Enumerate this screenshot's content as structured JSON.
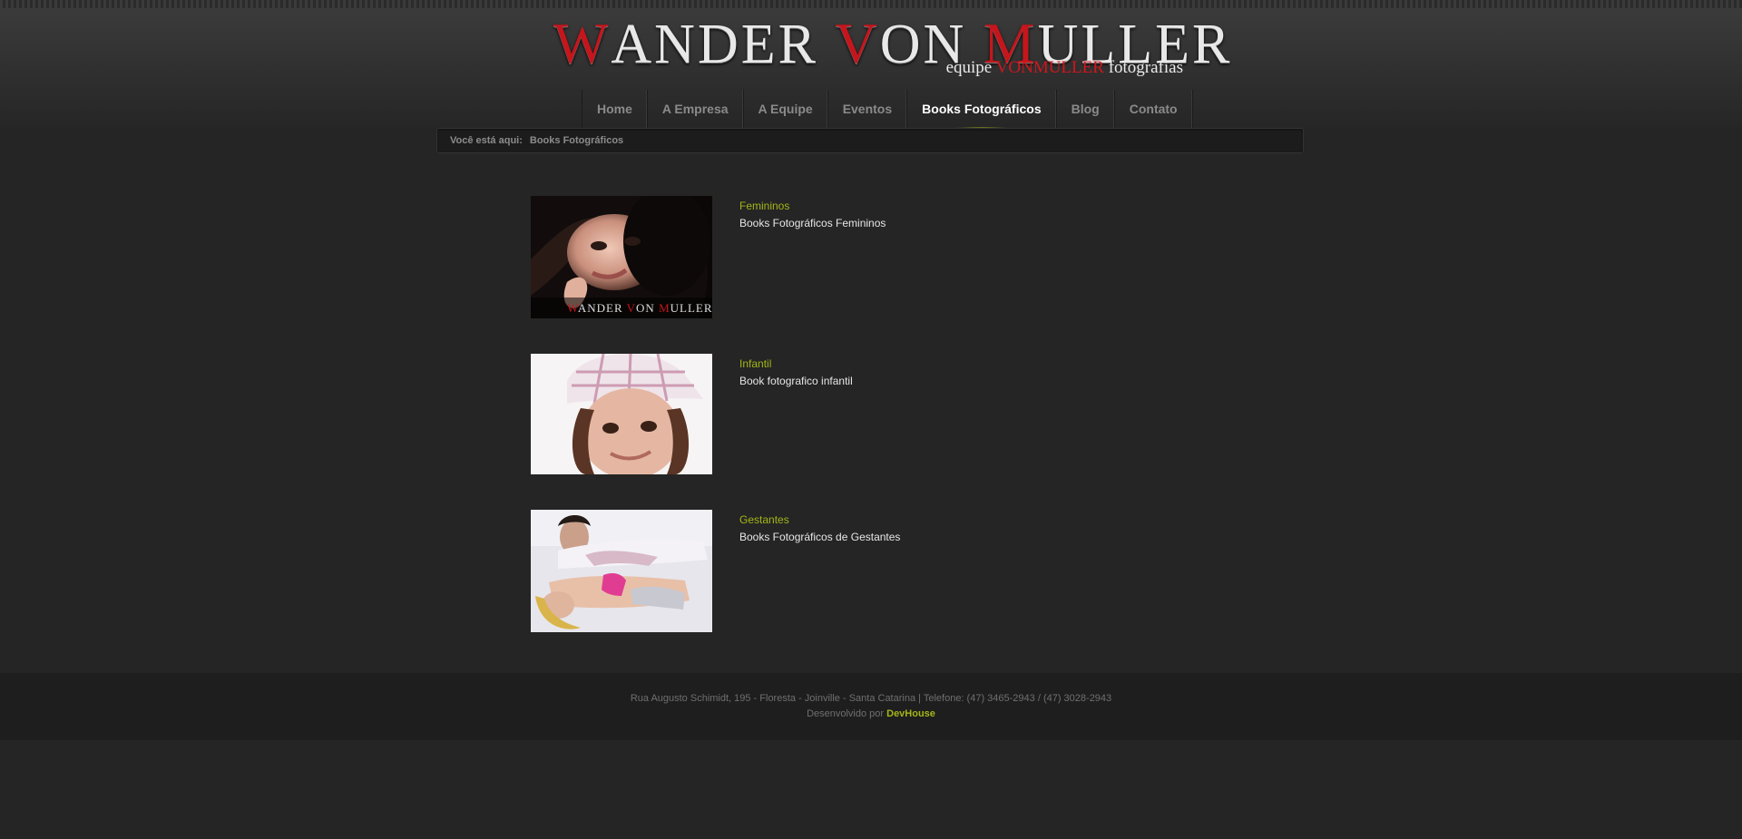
{
  "logo": {
    "title_parts": [
      {
        "text": "W",
        "red": true
      },
      {
        "text": "ANDER ",
        "red": false
      },
      {
        "text": "V",
        "red": true
      },
      {
        "text": "ON ",
        "red": false
      },
      {
        "text": "M",
        "red": true
      },
      {
        "text": "ULLER",
        "red": false
      }
    ],
    "sub_before": "equipe ",
    "sub_red": "VONMULLER",
    "sub_after": " fotografias"
  },
  "nav": {
    "items": [
      "Home",
      "A Empresa",
      "A Equipe",
      "Eventos",
      "Books Fotográficos",
      "Blog",
      "Contato"
    ],
    "active": "Books Fotográficos"
  },
  "breadcrumb": {
    "label": "Você está aqui:",
    "current": "Books Fotográficos"
  },
  "items": [
    {
      "title": "Femininos",
      "desc": "Books Fotográficos Femininos"
    },
    {
      "title": "Infantil",
      "desc": "Book fotografico infantil"
    },
    {
      "title": "Gestantes",
      "desc": "Books Fotográficos de Gestantes"
    }
  ],
  "thumb_watermark": {
    "parts": [
      {
        "text": "W",
        "red": true
      },
      {
        "text": "ANDER ",
        "red": false
      },
      {
        "text": "V",
        "red": true
      },
      {
        "text": "ON ",
        "red": false
      },
      {
        "text": "M",
        "red": true
      },
      {
        "text": "ULLER",
        "red": false
      }
    ]
  },
  "footer": {
    "address": "Rua Augusto Schimidt, 195 - Floresta - Joinville - Santa Catarina | Telefone: (47) 3465-2943 / (47) 3028-2943",
    "dev_label": "Desenvolvido por",
    "dev_name": "DevHouse"
  },
  "colors": {
    "accent": "#a4b518",
    "brand_red": "#c4161c",
    "background": "#252525"
  }
}
